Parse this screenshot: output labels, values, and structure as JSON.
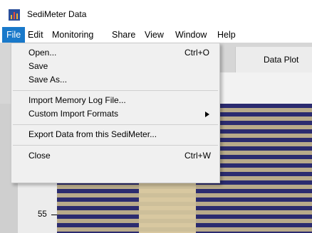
{
  "window": {
    "title": "SediMeter Data",
    "app_icon": "chart-app-icon"
  },
  "menubar": [
    "File",
    "Edit",
    "Monitoring",
    "Share",
    "View",
    "Window",
    "Help"
  ],
  "file_menu": {
    "open": {
      "label": "Open...",
      "shortcut": "Ctrl+O"
    },
    "save": {
      "label": "Save"
    },
    "save_as": {
      "label": "Save As..."
    },
    "import_log": {
      "label": "Import Memory Log File..."
    },
    "custom_import": {
      "label": "Custom Import Formats",
      "submenu_icon": "chevron-right-icon"
    },
    "export": {
      "label": "Export Data from this SediMeter..."
    },
    "close": {
      "label": "Close",
      "shortcut": "Ctrl+W"
    }
  },
  "panel": {
    "title": "Data Plot"
  },
  "axis": {
    "tick_label": "55"
  },
  "colors": {
    "accent": "#1979ca",
    "stripe_dark": "#2b2b6f",
    "stripe_tan": "#b8aa8a",
    "stripe_light": "#d8c8a0"
  }
}
